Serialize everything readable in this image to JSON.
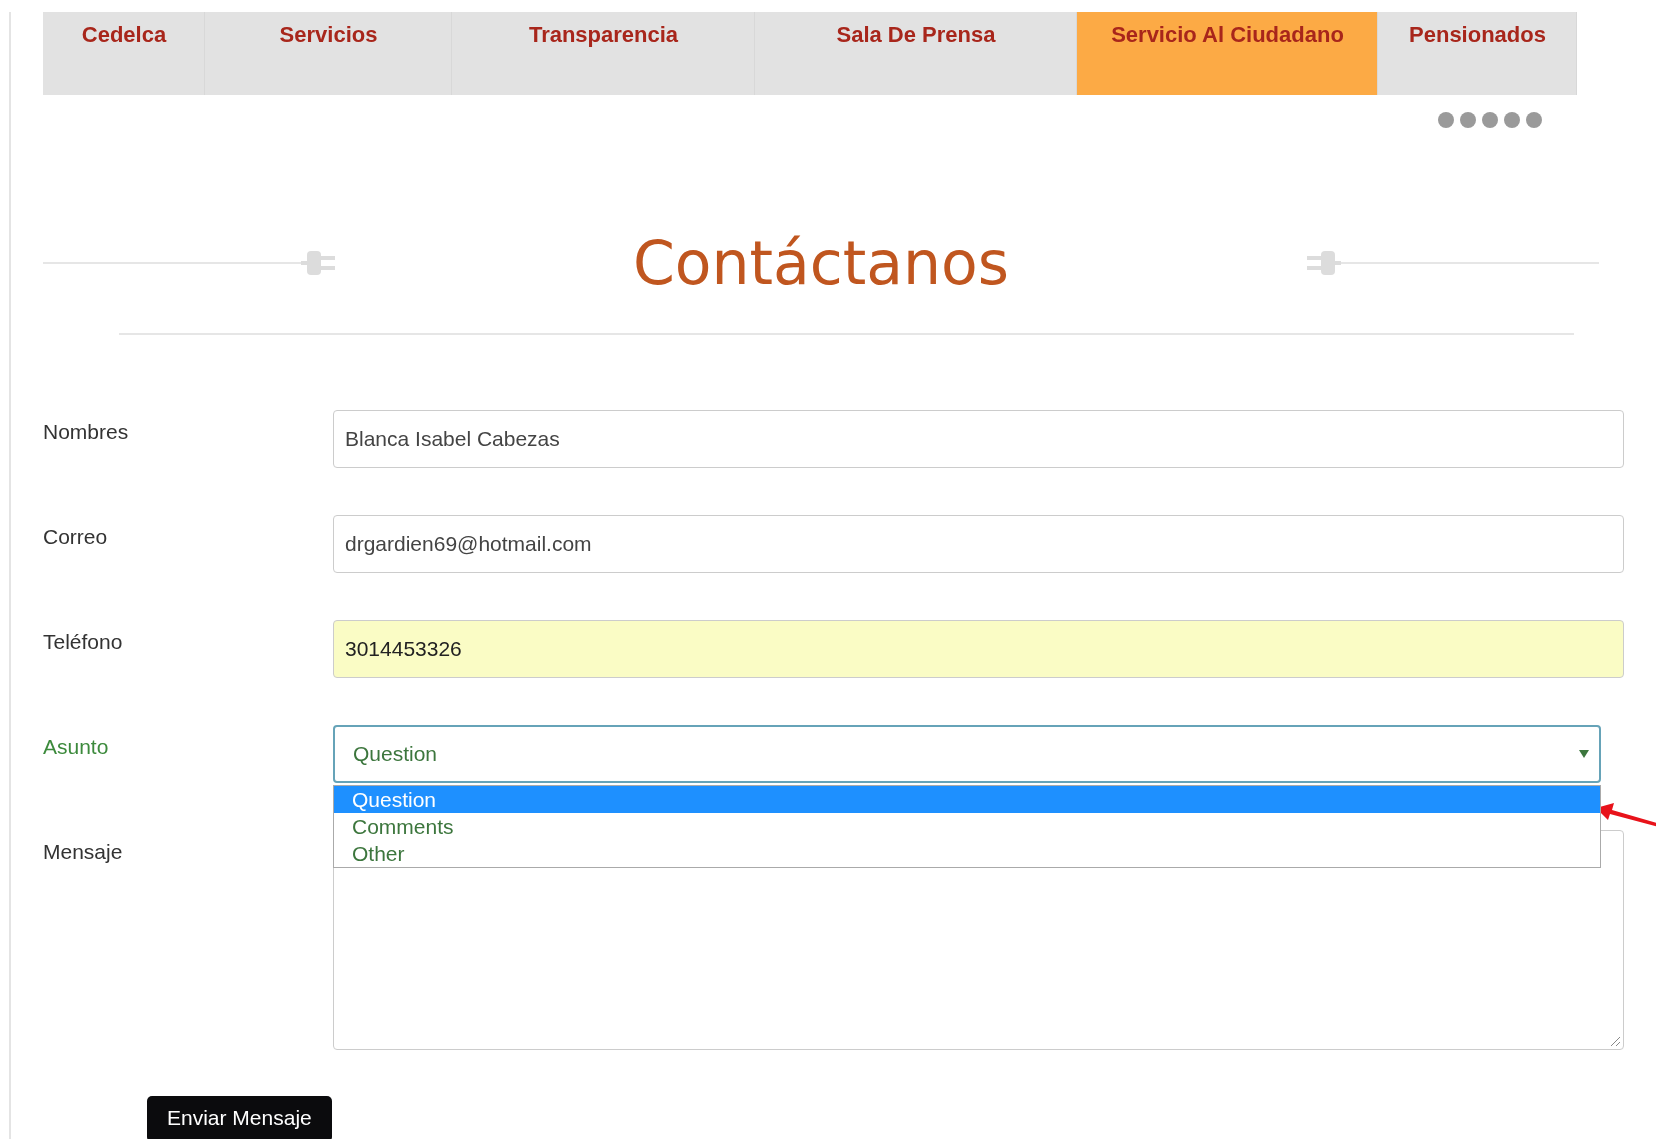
{
  "nav": {
    "tabs": [
      {
        "label": "Cedelca",
        "selected": false
      },
      {
        "label": "Servicios",
        "selected": false
      },
      {
        "label": "Transparencia",
        "selected": false
      },
      {
        "label": "Sala De Prensa",
        "selected": false
      },
      {
        "label": "Servicio Al Ciudadano",
        "selected": true
      },
      {
        "label": "Pensionados",
        "selected": false
      }
    ]
  },
  "heading": "Contáctanos",
  "form": {
    "fields": [
      {
        "kind": "text",
        "label": "Nombres",
        "value": "Blanca Isabel Cabezas",
        "autofilled": false,
        "valid": false
      },
      {
        "kind": "text",
        "label": "Correo",
        "value": "drgardien69@hotmail.com",
        "autofilled": false,
        "valid": false
      },
      {
        "kind": "text",
        "label": "Teléfono",
        "value": "3014453326",
        "autofilled": true,
        "valid": false
      },
      {
        "kind": "select",
        "label": "Asunto",
        "value": "Question",
        "valid": true,
        "expanded": true,
        "options": [
          {
            "label": "Question",
            "selected": true
          },
          {
            "label": "Comments",
            "selected": false
          },
          {
            "label": "Other",
            "selected": false
          }
        ]
      },
      {
        "kind": "textarea",
        "label": "Mensaje",
        "valid": false
      }
    ],
    "submit": "Enviar Mensaje"
  }
}
